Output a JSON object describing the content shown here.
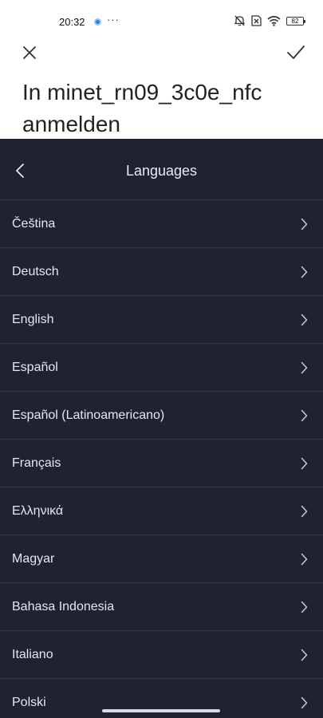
{
  "status_bar": {
    "time": "20:32",
    "more": "···",
    "battery": "82"
  },
  "header": {
    "title": "In minet_rn09_3c0e_nfc anmelden"
  },
  "panel": {
    "title": "Languages",
    "items": [
      {
        "label": "Čeština"
      },
      {
        "label": "Deutsch"
      },
      {
        "label": "English"
      },
      {
        "label": "Español"
      },
      {
        "label": "Español (Latinoamericano)"
      },
      {
        "label": "Français"
      },
      {
        "label": "Ελληνικά"
      },
      {
        "label": "Magyar"
      },
      {
        "label": "Bahasa Indonesia"
      },
      {
        "label": "Italiano"
      },
      {
        "label": "Polski"
      }
    ]
  },
  "icons": {
    "close": "close-icon",
    "confirm": "checkmark-icon",
    "back": "chevron-left-icon",
    "item_arrow": "chevron-right-icon"
  },
  "colors": {
    "panel_bg": "#1f2230",
    "divider": "#343846",
    "text_light": "#e6e8ee"
  }
}
